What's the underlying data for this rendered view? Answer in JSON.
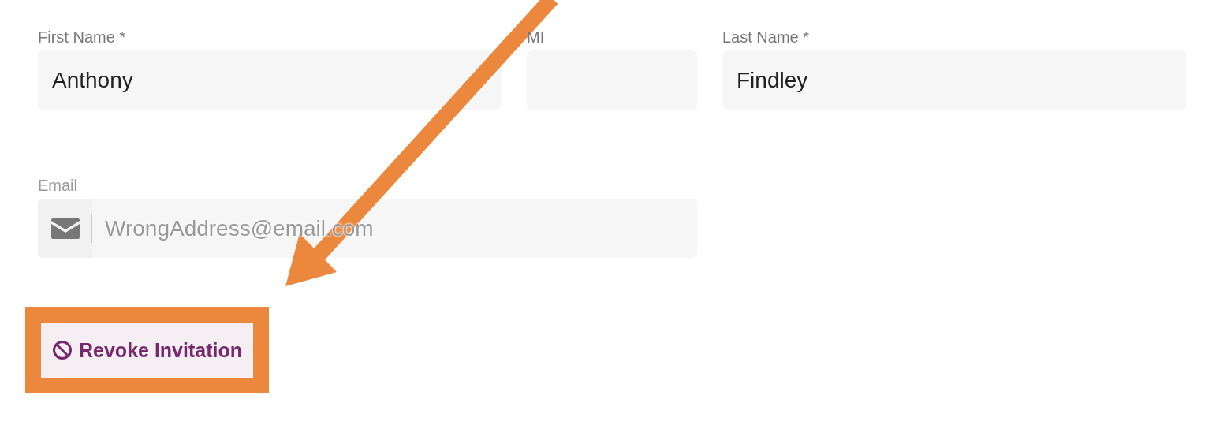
{
  "name_fields": [
    {
      "label": "First Name *",
      "value": "Anthony",
      "kind": "wide"
    },
    {
      "label": "MI",
      "kind": "narrow"
    },
    {
      "label": "Last Name *",
      "value": "Findley",
      "kind": "wide"
    }
  ],
  "email": {
    "label": "Email",
    "value": "WrongAddress@email.com",
    "disabled": true
  },
  "revoke_button": {
    "label": "Revoke Invitation"
  }
}
